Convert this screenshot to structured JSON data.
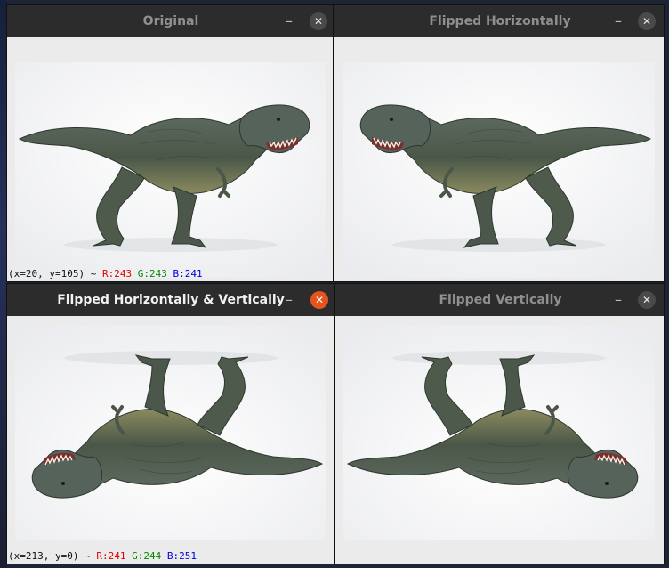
{
  "windows": [
    {
      "title": "Original",
      "active": false,
      "minimize_glyph": "–",
      "close_glyph": "✕",
      "status": {
        "coords": "(x=20, y=105) ~ ",
        "r": "R:243",
        "g": "G:243",
        "b": "B:241"
      }
    },
    {
      "title": "Flipped Horizontally",
      "active": false,
      "minimize_glyph": "–",
      "close_glyph": "✕"
    },
    {
      "title": "Flipped Horizontally & Vertically",
      "active": true,
      "minimize_glyph": "–",
      "close_glyph": "✕",
      "status": {
        "coords": "(x=213, y=0) ~ ",
        "r": "R:241",
        "g": "G:244",
        "b": "B:251"
      }
    },
    {
      "title": "Flipped Vertically",
      "active": false,
      "minimize_glyph": "–",
      "close_glyph": "✕"
    }
  ],
  "colors": {
    "titlebar": "#2c2c2c",
    "active_close": "#e3541f",
    "red": "#dd0000",
    "green": "#008800",
    "blue": "#0000dd",
    "dino_body": "#5e6a5c",
    "dino_dark": "#3b4438"
  }
}
